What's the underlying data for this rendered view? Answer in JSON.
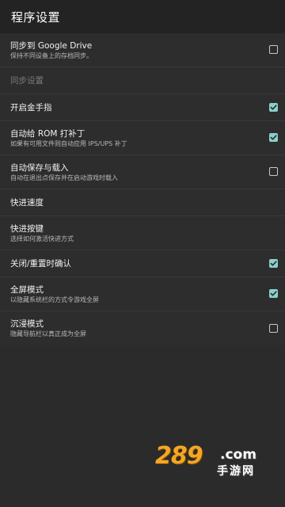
{
  "appbar": {
    "title": "程序设置"
  },
  "settings": [
    {
      "title": "同步到 Google Drive",
      "subtitle": "保持不同设备上的存档同步。",
      "checked": false
    },
    {
      "header": "同步设置"
    },
    {
      "title": "开启金手指",
      "checked": true
    },
    {
      "title": "自动给 ROM 打补丁",
      "subtitle": "如果有可用文件则自动应用 IPS/UPS 补丁",
      "checked": true
    },
    {
      "title": "自动保存与载入",
      "subtitle": "自动在退出点保存并在启动游戏时载入",
      "checked": false
    },
    {
      "title": "快进速度"
    },
    {
      "title": "快进按键",
      "subtitle": "选择如何激活快进方式"
    },
    {
      "title": "关闭/重置时确认",
      "checked": true
    },
    {
      "title": "全屏模式",
      "subtitle": "以隐藏系统栏的方式令游戏全屏",
      "checked": true
    },
    {
      "title": "沉浸模式",
      "subtitle": "隐藏导航栏以真正成为全屏",
      "checked": false
    }
  ],
  "watermark": {
    "number": "289",
    "domain": ".com",
    "site": "手游网"
  },
  "colors": {
    "accent": "#8ad0c9",
    "background": "#2b2b2b",
    "appbar": "#232323"
  }
}
